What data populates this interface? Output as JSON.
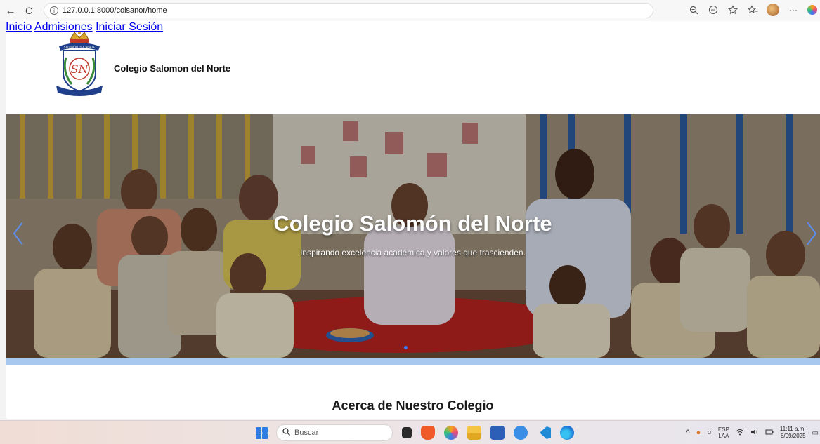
{
  "browser": {
    "url": "127.0.0.1:8000/colsanor/home",
    "back_glyph": "←",
    "refresh_glyph": "C",
    "info_glyph": "i",
    "more_glyph": "···"
  },
  "site": {
    "brand_name": "Colegio Salomon del Norte",
    "logo_monogram": "SN",
    "logo_banner_text": "SALOMÓN DEL NORTE",
    "nav": [
      "Inicio",
      "Admisiones",
      "Iniciar Sesión"
    ]
  },
  "hero": {
    "title": "Colegio Salomón del Norte",
    "subtitle": "Inspirando excelencia académica y valores que trascienden."
  },
  "section": {
    "title": "Acerca de Nuestro Colegio"
  },
  "taskbar": {
    "search_placeholder": "Buscar",
    "lang_top": "ESP",
    "lang_bottom": "LAA",
    "time": "11:11 a.m.",
    "date": "8/09/2025"
  },
  "colors": {
    "accent": "#3a7cf5",
    "strip": "#a8c8f0"
  },
  "icons": [
    "back-icon",
    "refresh-icon",
    "info-icon",
    "zoom-icon",
    "reading-icon",
    "favorite-icon",
    "favorites-icon",
    "profile-avatar",
    "more-icon",
    "copilot-icon",
    "windows-start-icon",
    "search-icon",
    "chevron-left-icon",
    "chevron-right-icon"
  ]
}
